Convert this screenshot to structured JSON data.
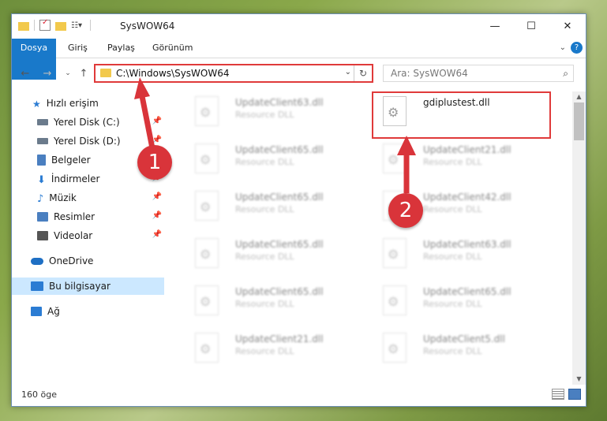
{
  "window": {
    "title": "SysWOW64",
    "controls": {
      "minimize": "—",
      "maximize": "☐",
      "close": "✕"
    }
  },
  "ribbon": {
    "tabs": [
      "Dosya",
      "Giriş",
      "Paylaş",
      "Görünüm"
    ]
  },
  "nav": {
    "address": "C:\\Windows\\SysWOW64",
    "search_placeholder": "Ara: SysWOW64"
  },
  "sidebar": {
    "items": [
      {
        "label": "Hızlı erişim",
        "icon": "star-icon",
        "color": "#2b7cd3"
      },
      {
        "label": "Yerel Disk (C:)",
        "icon": "drive-icon",
        "color": "#6b7b8c",
        "pinned": true
      },
      {
        "label": "Yerel Disk (D:)",
        "icon": "drive-icon",
        "color": "#6b7b8c",
        "pinned": true
      },
      {
        "label": "Belgeler",
        "icon": "documents-icon",
        "color": "#4a7fc0",
        "pinned": true
      },
      {
        "label": "İndirmeler",
        "icon": "download-icon",
        "color": "#2b7cd3",
        "pinned": true
      },
      {
        "label": "Müzik",
        "icon": "music-icon",
        "color": "#2b7cd3",
        "pinned": true
      },
      {
        "label": "Resimler",
        "icon": "pictures-icon",
        "color": "#4a7fc0",
        "pinned": true
      },
      {
        "label": "Videolar",
        "icon": "videos-icon",
        "color": "#555555",
        "pinned": true
      },
      {
        "label": "OneDrive",
        "icon": "cloud-icon",
        "color": "#1e6fc4"
      },
      {
        "label": "Bu bilgisayar",
        "icon": "computer-icon",
        "color": "#2b7cd3",
        "selected": true
      },
      {
        "label": "Ağ",
        "icon": "network-icon",
        "color": "#2b7cd3"
      }
    ]
  },
  "files": {
    "left": [
      {
        "name": "UpdateClient63.dll",
        "desc": "Resource DLL"
      },
      {
        "name": "UpdateClient65.dll",
        "desc": "Resource DLL"
      },
      {
        "name": "UpdateClient65.dll",
        "desc": "Resource DLL"
      },
      {
        "name": "UpdateClient65.dll",
        "desc": "Resource DLL"
      },
      {
        "name": "UpdateClient65.dll",
        "desc": "Resource DLL"
      },
      {
        "name": "UpdateClient21.dll",
        "desc": "Resource DLL"
      }
    ],
    "right": [
      {
        "name": "gdiplustest.dll",
        "desc": "",
        "highlighted": true
      },
      {
        "name": "UpdateClient21.dll",
        "desc": "Resource DLL"
      },
      {
        "name": "UpdateClient42.dll",
        "desc": "Resource DLL"
      },
      {
        "name": "UpdateClient63.dll",
        "desc": "Resource DLL"
      },
      {
        "name": "UpdateClient65.dll",
        "desc": "Resource DLL"
      },
      {
        "name": "UpdateClient5.dll",
        "desc": "Resource DLL"
      }
    ]
  },
  "status": {
    "count": "160 öge"
  },
  "annotations": {
    "badge1": "1",
    "badge2": "2",
    "color": "#d9343a"
  }
}
